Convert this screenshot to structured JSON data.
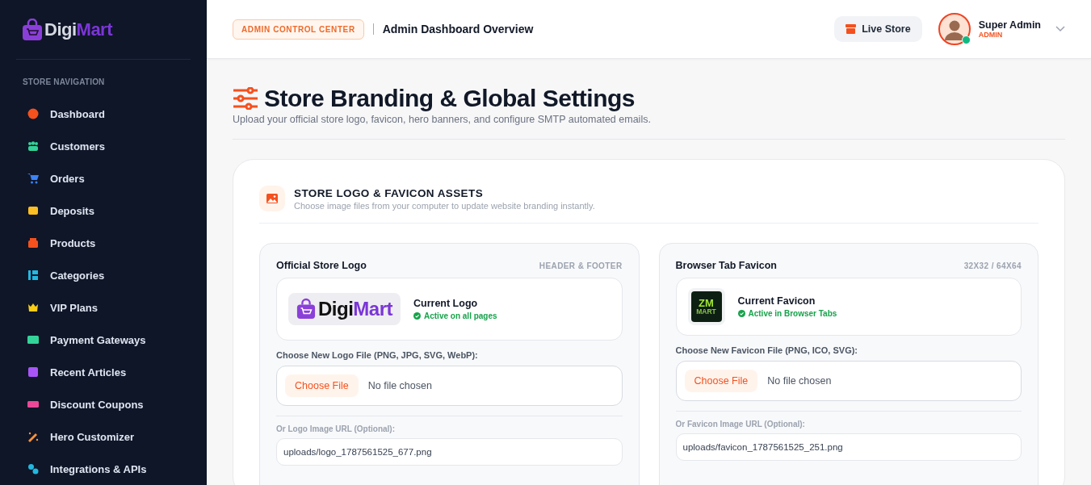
{
  "sidebar": {
    "logo": {
      "part_1": "Digi",
      "part_2": "Mart"
    },
    "section_title": "STORE NAVIGATION",
    "items": [
      {
        "label": "Dashboard",
        "color": "#f4511e"
      },
      {
        "label": "Customers",
        "color": "#34d399"
      },
      {
        "label": "Orders",
        "color": "#3b82f6"
      },
      {
        "label": "Deposits",
        "color": "#fbbf24"
      },
      {
        "label": "Products",
        "color": "#f4511e"
      },
      {
        "label": "Categories",
        "color": "#22b8e0"
      },
      {
        "label": "VIP Plans",
        "color": "#facc15"
      },
      {
        "label": "Payment Gateways",
        "color": "#34d399"
      },
      {
        "label": "Recent Articles",
        "color": "#a855f7"
      },
      {
        "label": "Discount Coupons",
        "color": "#ec4899"
      },
      {
        "label": "Hero Customizer",
        "color": "#fb923c"
      },
      {
        "label": "Integrations & APIs",
        "color": "#22b8e0"
      }
    ]
  },
  "header": {
    "badge": "ADMIN CONTROL CENTER",
    "title": "Admin Dashboard Overview",
    "live_store": "Live Store",
    "user": {
      "name": "Super Admin",
      "role": "ADMIN",
      "online": true
    }
  },
  "page": {
    "title": "Store Branding & Global Settings",
    "subtitle": "Upload your official store logo, favicon, hero banners, and configure SMTP automated emails."
  },
  "section": {
    "title": "STORE LOGO & FAVICON ASSETS",
    "subtitle": "Choose image files from your computer to update website branding instantly.",
    "panels": [
      {
        "kind": "logo",
        "title": "Official Store Logo",
        "tag": "HEADER & FOOTER",
        "preview": {
          "wordmark_1": "Digi",
          "wordmark_2": "Mart"
        },
        "current_label": "Current Logo",
        "status": "Active on all pages",
        "file_label": "Choose New Logo File (PNG, JPG, SVG, WebP):",
        "choose_button": "Choose File",
        "file_status": "No file chosen",
        "url_label": "Or Logo Image URL (Optional):",
        "url_value": "uploads/logo_1787561525_677.png"
      },
      {
        "kind": "favicon",
        "title": "Browser Tab Favicon",
        "tag": "32X32 / 64X64",
        "preview": {
          "wordmark_1": "ZM",
          "wordmark_2": "MART"
        },
        "current_label": "Current Favicon",
        "status": "Active in Browser Tabs",
        "file_label": "Choose New Favicon File (PNG, ICO, SVG):",
        "choose_button": "Choose File",
        "file_status": "No file chosen",
        "url_label": "Or Favicon Image URL (Optional):",
        "url_value": "uploads/favicon_1787561525_251.png"
      }
    ]
  }
}
